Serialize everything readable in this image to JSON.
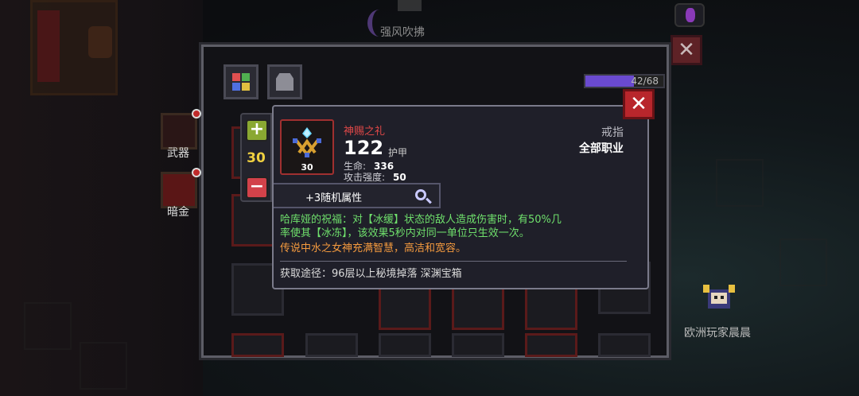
{
  "world": {
    "top_label": "强风吹拂",
    "player_name": "欧洲玩家晨晨",
    "accent_purple": "#6a4ad0"
  },
  "panel": {
    "xp_text": "42/68",
    "xp_fraction": 0.62,
    "side_buttons": [
      {
        "label": "武器",
        "icon": "weapon-icon"
      },
      {
        "label": "暗金",
        "icon": "chest-icon"
      }
    ]
  },
  "quantity": {
    "plus_label": "+",
    "value": "30",
    "minus_label": "−"
  },
  "tooltip": {
    "name": "神赐之礼",
    "armor_value": "122",
    "armor_label": "护甲",
    "icon_level": "30",
    "stats": [
      {
        "label": "生命:",
        "value": "336"
      },
      {
        "label": "攻击强度:",
        "value": "50"
      }
    ],
    "item_type": "戒指",
    "class": "全部职业",
    "random_attr": "+3随机属性",
    "desc_green_1": "哈库娅的祝福：对【冰缓】状态的敌人造成伤害时，有50%几",
    "desc_green_2": "率使其【冰冻】，该效果5秒内对同一单位只生效一次。",
    "desc_orange": "传说中水之女神充满智慧，高洁和宽容。",
    "source": "获取途径：96层以上秘境掉落 深渊宝箱",
    "colors": {
      "name": "#e04848",
      "effect": "#6fe06c",
      "lore": "#f49a3e"
    }
  },
  "close_label": "✕"
}
